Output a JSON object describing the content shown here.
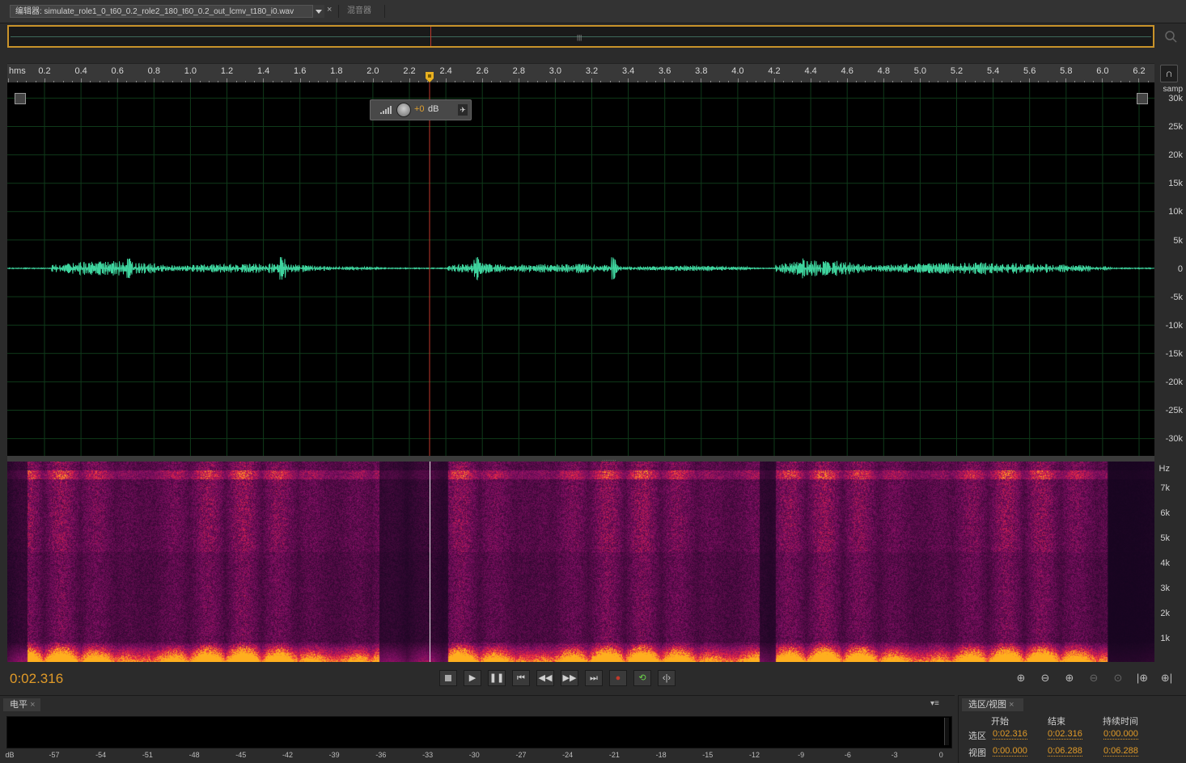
{
  "tabs": {
    "editor_label": "编辑器: simulate_role1_0_t60_0.2_role2_180_t60_0.2_out_lcmv_t180_i0.wav",
    "close": "×",
    "mixer_label": "混音器"
  },
  "ruler": {
    "unit": "hms",
    "ticks": [
      "0.2",
      "0.4",
      "0.6",
      "0.8",
      "1.0",
      "1.2",
      "1.4",
      "1.6",
      "1.8",
      "2.0",
      "2.2",
      "2.4",
      "2.6",
      "2.8",
      "3.0",
      "3.2",
      "3.4",
      "3.6",
      "3.8",
      "4.0",
      "4.2",
      "4.4",
      "4.6",
      "4.8",
      "5.0",
      "5.2",
      "5.4",
      "5.6",
      "5.8",
      "6.0",
      "6.2"
    ]
  },
  "volume_hud": {
    "value": "+0",
    "unit": "dB",
    "pin_icon": "pin-icon"
  },
  "amplitude_scale": {
    "unit": "samp",
    "labels": [
      "30k",
      "25k",
      "20k",
      "15k",
      "10k",
      "5k",
      "0",
      "-5k",
      "-10k",
      "-15k",
      "-20k",
      "-25k",
      "-30k"
    ]
  },
  "frequency_scale": {
    "unit": "Hz",
    "labels": [
      "7k",
      "6k",
      "5k",
      "4k",
      "3k",
      "2k",
      "1k"
    ]
  },
  "transport": {
    "time": "0:02.316",
    "buttons": [
      "stop-icon",
      "play-icon",
      "pause-icon",
      "go-to-start-icon",
      "rewind-icon",
      "fast-forward-icon",
      "go-to-end-icon",
      "record-icon",
      "loop-icon",
      "skip-selection-icon"
    ],
    "zoom_buttons": [
      "zoom-in-amplitude-icon",
      "zoom-out-amplitude-icon",
      "zoom-in-time-icon",
      "zoom-out-time-icon",
      "zoom-reset-icon",
      "zoom-in-left-icon",
      "zoom-in-right-icon"
    ]
  },
  "levels": {
    "tab": "电平",
    "menu": "▾≡",
    "scale": [
      "dB",
      "-57",
      "-54",
      "-51",
      "-48",
      "-45",
      "-42",
      "-39",
      "-36",
      "-33",
      "-30",
      "-27",
      "-24",
      "-21",
      "-18",
      "-15",
      "-12",
      "-9",
      "-6",
      "-3",
      "0"
    ]
  },
  "selection_view": {
    "tab": "选区/视图",
    "columns": [
      "开始",
      "结束",
      "持续时间"
    ],
    "rows": [
      {
        "label": "选区",
        "start": "0:02.316",
        "end": "0:02.316",
        "duration": "0:00.000"
      },
      {
        "label": "视图",
        "start": "0:00.000",
        "end": "0:06.288",
        "duration": "0:06.288"
      }
    ]
  },
  "colors": {
    "waveform": "#3fd49e",
    "accent": "#e09a28",
    "playhead": "#c0392b",
    "grid": "#0f3a1a"
  }
}
